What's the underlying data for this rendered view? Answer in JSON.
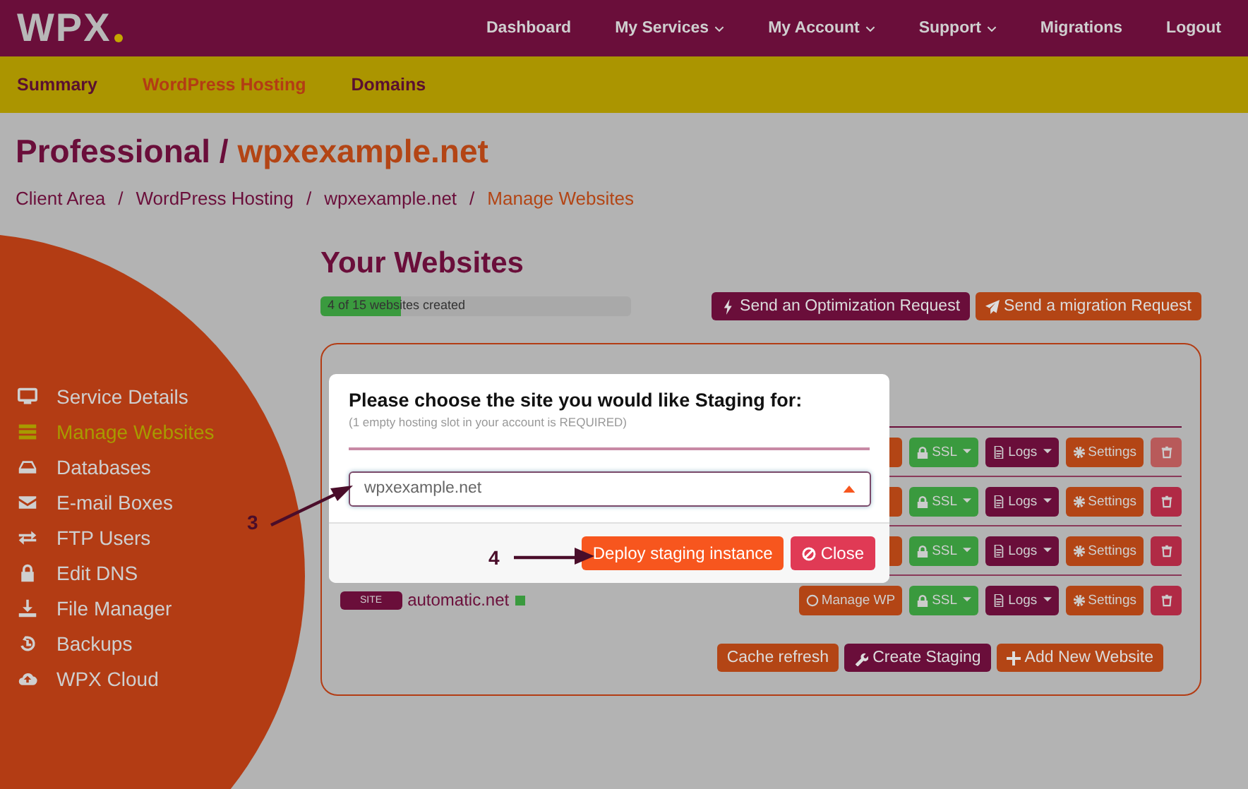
{
  "brand": {
    "logo": "WPX"
  },
  "nav": [
    {
      "label": "Dashboard",
      "dropdown": false
    },
    {
      "label": "My Services",
      "dropdown": true
    },
    {
      "label": "My Account",
      "dropdown": true
    },
    {
      "label": "Support",
      "dropdown": true
    },
    {
      "label": "Migrations",
      "dropdown": false
    },
    {
      "label": "Logout",
      "dropdown": false
    }
  ],
  "subnav": [
    {
      "label": "Summary",
      "selected": false
    },
    {
      "label": "WordPress Hosting",
      "selected": true
    },
    {
      "label": "Domains",
      "selected": false
    }
  ],
  "title": {
    "plan": "Professional /",
    "domain": "wpxexample.net"
  },
  "breadcrumb": [
    {
      "label": "Client Area",
      "separator": "/",
      "current": false
    },
    {
      "label": "WordPress Hosting",
      "separator": "/",
      "current": false
    },
    {
      "label": "wpxexample.net",
      "separator": "/",
      "current": false
    },
    {
      "label": "Manage Websites",
      "current": true
    }
  ],
  "sidebar": [
    {
      "label": "Service Details",
      "kind": "monitor",
      "selected": false
    },
    {
      "label": "Manage Websites",
      "kind": "server",
      "selected": true
    },
    {
      "label": "Databases",
      "kind": "drive",
      "selected": false
    },
    {
      "label": "E-mail Boxes",
      "kind": "mail",
      "selected": false
    },
    {
      "label": "FTP Users",
      "kind": "swap",
      "selected": false
    },
    {
      "label": "Edit DNS",
      "kind": "lock",
      "selected": false
    },
    {
      "label": "File Manager",
      "kind": "download",
      "selected": false
    },
    {
      "label": "Backups",
      "kind": "history",
      "selected": false
    },
    {
      "label": "WPX Cloud",
      "kind": "cloud",
      "selected": false
    }
  ],
  "websites": {
    "heading": "Your Websites",
    "progress": {
      "label": "4 of 15 websites created",
      "level": 0.26
    },
    "actions": [
      {
        "label": "Send an Optimization Request",
        "kind": "optimize"
      },
      {
        "label": "Send a migration Request",
        "kind": "migrate"
      }
    ],
    "rows": [
      {
        "ssl": "SSL",
        "logs": "Logs",
        "settings": "Settings",
        "delete_disabled": true
      },
      {
        "ssl": "SSL",
        "logs": "Logs",
        "settings": "Settings",
        "delete_disabled": false
      },
      {
        "ssl": "SSL",
        "logs": "Logs",
        "settings": "Settings",
        "delete_disabled": false
      },
      {
        "badge": "SITE",
        "name": "automatic.net",
        "manage": "Manage WP",
        "ssl": "SSL",
        "logs": "Logs",
        "settings": "Settings",
        "delete_disabled": false
      }
    ],
    "buttons": [
      {
        "label": "Cache refresh",
        "kind": "refresh"
      },
      {
        "label": "Create Staging",
        "kind": "staging"
      },
      {
        "label": "Add New Website",
        "kind": "add"
      }
    ]
  },
  "modal": {
    "title": "Please choose the site you would like Staging for:",
    "note": "(1 empty hosting slot in your account is REQUIRED)",
    "select": {
      "value": "wpxexample.net",
      "expanded": true
    },
    "buttons": [
      {
        "label": "Deploy staging instance",
        "kind": "primary"
      },
      {
        "label": "Close",
        "kind": "close"
      }
    ]
  },
  "annotations": [
    {
      "label": "3"
    },
    {
      "label": "4"
    }
  ]
}
